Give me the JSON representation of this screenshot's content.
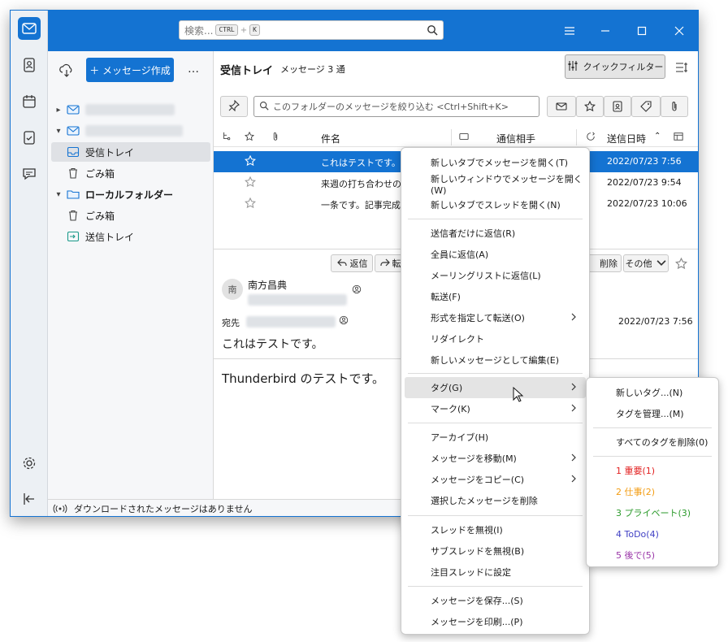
{
  "search": {
    "placeholder": "検索...",
    "kbd1": "CTRL",
    "plus": "+",
    "kbd2": "K"
  },
  "folders": {
    "new_message": "＋ メッセージ作成",
    "more": "…",
    "inbox": "受信トレイ",
    "trash1": "ごみ箱",
    "local": "ローカルフォルダー",
    "trash2": "ごみ箱",
    "outbox": "送信トレイ"
  },
  "list": {
    "folder_title": "受信トレイ",
    "count": "メッセージ 3 通",
    "quickfilter": "クイックフィルター",
    "filter_placeholder": "このフォルダーのメッセージを絞り込む <Ctrl+Shift+K>",
    "col_subject": "件名",
    "col_correspondent": "通信相手",
    "col_date": "送信日時",
    "rows": [
      {
        "subject": "これはテストです。",
        "date": "2022/07/23 7:56"
      },
      {
        "subject": "来週の打ち合わせの",
        "date": "2022/07/23 9:54"
      },
      {
        "subject": "一条です。記事完成",
        "date": "2022/07/23 10:06"
      }
    ]
  },
  "header": {
    "reply": "返信",
    "forward_short": "転",
    "delete": "削除",
    "other": "その他",
    "avatar": "南",
    "from_name": "南方昌典",
    "to_label": "宛先",
    "date": "2022/07/23 7:56",
    "subject": "これはテストです。",
    "body": "Thunderbird のテストです。"
  },
  "status": {
    "text": "ダウンロードされたメッセージはありません"
  },
  "context_menu": {
    "items": [
      "新しいタブでメッセージを開く(T)",
      "新しいウィンドウでメッセージを開く(W)",
      "新しいタブでスレッドを開く(N)",
      "送信者だけに返信(R)",
      "全員に返信(A)",
      "メーリングリストに返信(L)",
      "転送(F)",
      "形式を指定して転送(O)",
      "リダイレクト",
      "新しいメッセージとして編集(E)",
      "タグ(G)",
      "マーク(K)",
      "アーカイブ(H)",
      "メッセージを移動(M)",
      "メッセージをコピー(C)",
      "選択したメッセージを削除",
      "スレッドを無視(I)",
      "サブスレッドを無視(B)",
      "注目スレッドに設定",
      "メッセージを保存...(S)",
      "メッセージを印刷...(P)"
    ]
  },
  "tag_menu": {
    "items": [
      "新しいタグ...(N)",
      "タグを管理...(M)",
      "すべてのタグを削除(0)",
      "1 重要(1)",
      "2 仕事(2)",
      "3 プライベート(3)",
      "4 ToDo(4)",
      "5 後で(5)"
    ],
    "colors": [
      "#e21f1f",
      "#f39c12",
      "#2b9a2b",
      "#3f3fc4",
      "#9a36a8"
    ]
  }
}
